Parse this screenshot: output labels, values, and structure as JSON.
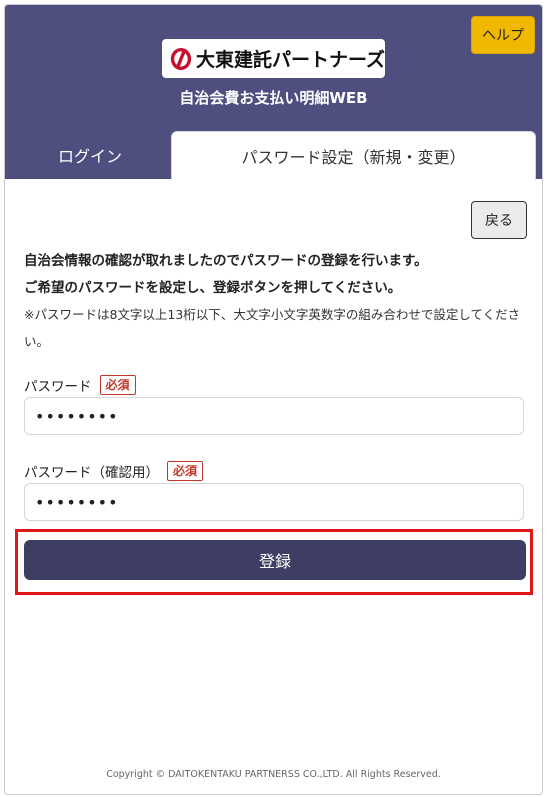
{
  "header": {
    "help_label": "ヘルプ",
    "logo_text": "大東建託パートナーズ",
    "app_title": "自治会費お支払い明細WEB",
    "colors": {
      "background": "#4e4f7f",
      "help_button": "#f1b800",
      "logo_mark": "#c8102e"
    }
  },
  "tabs": [
    {
      "label": "ログイン",
      "active": false
    },
    {
      "label": "パスワード設定（新規・変更）",
      "active": true
    }
  ],
  "main": {
    "back_label": "戻る",
    "message_line1": "自治会情報の確認が取れましたのでパスワードの登録を行います。",
    "message_line2": "ご希望のパスワードを設定し、登録ボタンを押してください。",
    "note": "※パスワードは8文字以上13桁以下、大文字小文字英数字の組み合わせで設定してください。",
    "password_label": "パスワード",
    "password_confirm_label": "パスワード（確認用）",
    "required_badge": "必須",
    "password_value": "••••••••",
    "password_confirm_value": "••••••••",
    "submit_label": "登録",
    "colors": {
      "submit": "#3e3d63",
      "highlight": "#e01818",
      "required": "#c0392b"
    }
  },
  "footer": {
    "copyright": "Copyright © DAITOKENTAKU PARTNERSS CO.,LTD. All Rights Reserved."
  }
}
